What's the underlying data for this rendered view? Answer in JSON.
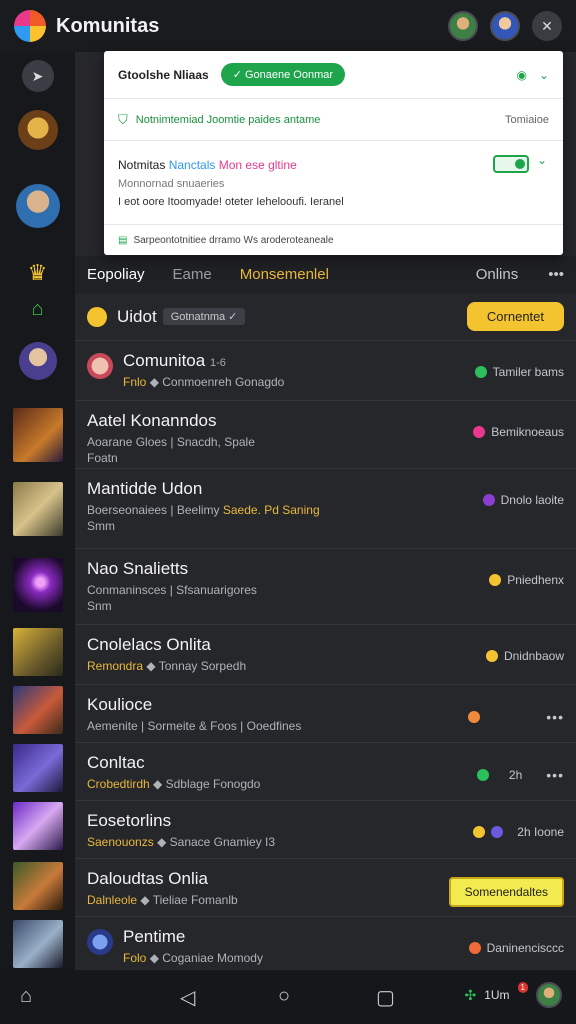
{
  "app": {
    "title": "Komunitas"
  },
  "top_bar": {
    "close_icon": "close-icon"
  },
  "popover": {
    "title": "Gtoolshe Nliaas",
    "pill": "✓ Gonaene Oonmar",
    "row2": "Notnimtemiad Joomtie paides antame",
    "row2_right": "Tomiaioe",
    "notice_title_a": "Notmitas",
    "notice_title_b": "Nanctals",
    "notice_title_c": "Mon ese gltine",
    "notice_sub": "Monnornad snuaeries",
    "notice_line": "I eot oore Itoomyade! oteter Iehelooufi. Ieranel",
    "footer": "Sarpeontotnitiee drramo Ws aroderoteaneale"
  },
  "tabs": {
    "items": [
      "Eopoliay",
      "Eame",
      "Monsemenlel"
    ],
    "right_label": "Onlins",
    "more": "•••"
  },
  "rows": [
    {
      "title": "Uidot",
      "badge": "Gotnatnma ✓",
      "button": "Cornentet"
    },
    {
      "title": "Comunitoa",
      "title_suffix": "1-6",
      "meta_gold": "Fnlo",
      "meta": "◆ Conmoenreh Gonagdo",
      "right": "Tamiler bams",
      "dot": "#2cc05c"
    },
    {
      "title": "Aatel Konanndos",
      "meta": "Aoarane Gloes | Snacdh, Spale",
      "meta2": "Foatn",
      "right": "Bemiknoeaus",
      "dot": "#e8398b"
    },
    {
      "title": "Mantidde Udon",
      "meta": "Boerseonaiees | Beelimy",
      "meta_gold": "Saede. Pd Saning",
      "meta2": "Smm",
      "right": "Dnolo laoite",
      "dot": "#8a3fd0"
    },
    {
      "title": "Nao Snalietts",
      "meta": "Conmaninsces | Sfsanuarigores",
      "meta2": "Snm",
      "right": "Pniedhenx",
      "dot": "#f4c430"
    },
    {
      "title": "Cnolelacs Onlita",
      "meta_gold": "Remondra",
      "meta": "◆ Tonnay Sorpedh",
      "right": "Dnidnbaow",
      "dot": "#f4c430"
    },
    {
      "title": "Koulioce",
      "meta": "Aemenite | Sormeite & Foos | Ooedfines",
      "right": "•••",
      "dot": "#f08a3a"
    },
    {
      "title": "Conltac",
      "meta_gold": "Crobedtirdh",
      "meta": "◆ Sdblage Fonogdo",
      "right": "2h",
      "right_more": "•••",
      "dot": "#2cc05c"
    },
    {
      "title": "Eosetorlins",
      "meta_gold": "Saenouonzs",
      "meta": "◆ Sanace Gnamiey I3",
      "right": "2h Ioone",
      "dot": "#f4c430"
    },
    {
      "title": "Daloudtas Onlia",
      "meta_gold": "Dalnleole",
      "meta": "◆ Tieliae Fomanlb",
      "button": "Somenendaltes"
    },
    {
      "title": "Pentime",
      "meta_gold": "Folo",
      "meta": "◆ Coganiae Momody",
      "right": "Daninencisccc",
      "dot": "#f06a3a"
    }
  ],
  "bottom_nav": {
    "user_label": "1Um",
    "notif_count": "1"
  }
}
